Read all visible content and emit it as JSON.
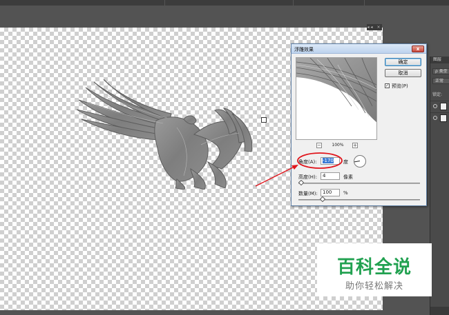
{
  "app": {
    "theme_bg": "#535353"
  },
  "canvas": {
    "panel_toggle": "◂◂ ×"
  },
  "layers_panel": {
    "tab_label": "图层",
    "search_label": "ρ 类型",
    "blend_mode": "正常",
    "lock_label": "锁定:",
    "layers": [
      {
        "visible": true
      },
      {
        "visible": true
      }
    ]
  },
  "dialog": {
    "title": "浮雕效果",
    "close_label": "x",
    "ok_label": "确定",
    "cancel_label": "取消",
    "preview_label": "预览(P)",
    "preview_checked": true,
    "zoom_out": "−",
    "zoom_value": "100%",
    "zoom_in": "+",
    "angle": {
      "label": "角度(A):",
      "value": "-170",
      "unit": "度",
      "degrees": -170
    },
    "height": {
      "label": "高度(H):",
      "value": "4",
      "unit": "像素",
      "fraction": 0.02
    },
    "amount": {
      "label": "数量(M):",
      "value": "100",
      "unit": "%",
      "fraction": 0.2
    }
  },
  "annotation": {
    "color": "#e0141b"
  },
  "watermark": {
    "title": "百科全说",
    "subtitle": "助你轻松解决",
    "title_color": "#21a150"
  }
}
